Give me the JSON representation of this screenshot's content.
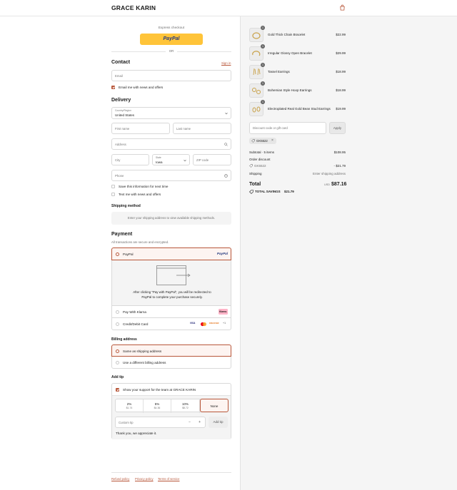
{
  "header": {
    "brand": "GRACE KARIN"
  },
  "express": {
    "label": "Express checkout",
    "paypal_label": "PayPal",
    "or": "OR"
  },
  "contact": {
    "title": "Contact",
    "signin": "Sign in",
    "email_placeholder": "Email",
    "newsletter": "Email me with news and offers"
  },
  "delivery": {
    "title": "Delivery",
    "country_label": "Country/Region",
    "country_value": "United States",
    "first_name": "First name",
    "last_name": "Last name",
    "address": "Address",
    "city": "City",
    "state_label": "State",
    "state_value": "Iowa",
    "zip": "ZIP code",
    "phone": "Phone",
    "save_info": "Save this information for next time",
    "text_me": "Text me with news and offers"
  },
  "shipping_method": {
    "title": "Shipping method",
    "placeholder": "Enter your shipping address to view available shipping methods."
  },
  "payment": {
    "title": "Payment",
    "subtitle": "All transactions are secure and encrypted.",
    "options": [
      {
        "label": "PayPal",
        "badge": "PayPal"
      },
      {
        "label": "Pay With Klarna",
        "badge": "Klarna."
      },
      {
        "label": "Credit/Debit Card",
        "cards": [
          "VISA",
          "MC",
          "DISCOVER",
          "+1"
        ]
      }
    ],
    "redirect_text": "After clicking \"Pay with PayPal\", you will be redirected to PayPal to complete your purchase securely."
  },
  "billing": {
    "title": "Billing address",
    "same": "Same as shipping address",
    "different": "Use a different billing address"
  },
  "tip": {
    "title": "Add tip",
    "support": "Show your support for the team at GRACE KARIN",
    "options": [
      {
        "pct": "2%",
        "amt": "$1.74"
      },
      {
        "pct": "5%",
        "amt": "$4.36"
      },
      {
        "pct": "10%",
        "amt": "$8.72"
      },
      {
        "pct": "None",
        "amt": ""
      }
    ],
    "custom_placeholder": "Custom tip",
    "add_label": "Add tip",
    "thanks": "Thank you, we appreciate it."
  },
  "footer": {
    "links": [
      "Refund policy",
      "Privacy policy",
      "Terms of service"
    ]
  },
  "order": {
    "items": [
      {
        "qty": "1",
        "name": "Gold Thick Chain Bracelet",
        "price": "$22.99"
      },
      {
        "qty": "1",
        "name": "Irregular Glossy Open Bracelet",
        "price": "$29.99"
      },
      {
        "qty": "1",
        "name": "Tassel Earrings",
        "price": "$18.99"
      },
      {
        "qty": "1",
        "name": "Bohemian Style Hoop Earrings",
        "price": "$18.99"
      },
      {
        "qty": "1",
        "name": "Electroplated Real Gold Bean Stud Earrings",
        "price": "$19.99"
      }
    ],
    "discount_placeholder": "Discount code or gift card",
    "apply": "Apply",
    "code_tag": "GK5522",
    "subtotal_label": "Subtotal · 5 items",
    "subtotal": "$108.95",
    "order_discount_label": "Order discount",
    "code_line": "GK5522",
    "discount_value": "- $21.79",
    "shipping_label": "Shipping",
    "shipping_value": "Enter shipping address",
    "total_label": "Total",
    "currency": "USD",
    "total": "$87.16",
    "savings_label": "TOTAL SAVINGS",
    "savings": "$21.79"
  },
  "colors": {
    "accent": "#b8573a",
    "paypal_yellow": "#ffc439",
    "klarna_pink": "#ffb3c7"
  }
}
